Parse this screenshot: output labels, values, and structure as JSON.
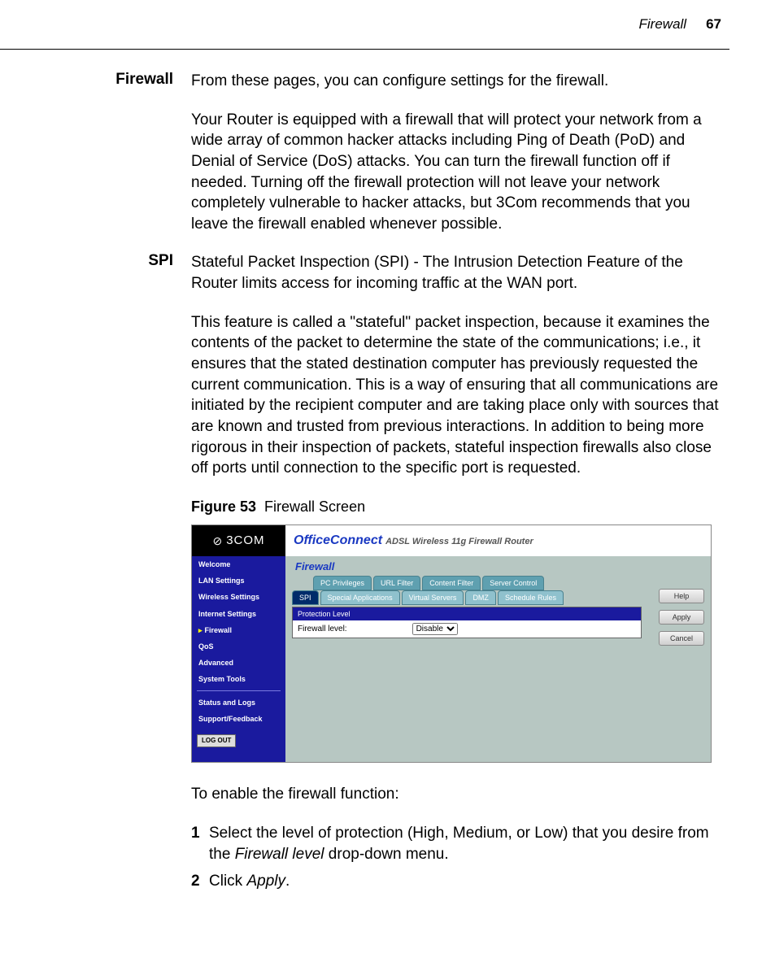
{
  "header": {
    "label": "Firewall",
    "page_number": "67"
  },
  "section1": {
    "heading": "Firewall",
    "p1": "From these pages, you can configure settings for the firewall.",
    "p2": "Your Router is equipped with a firewall that will protect your network from a wide array of common hacker attacks including Ping of Death (PoD) and Denial of Service (DoS) attacks. You can turn the firewall function off if needed. Turning off the firewall protection will not leave your network completely vulnerable to hacker attacks, but 3Com recommends that you leave the firewall enabled whenever possible."
  },
  "section2": {
    "heading": "SPI",
    "p1": "Stateful Packet Inspection (SPI) - The Intrusion Detection Feature of the Router limits access for incoming traffic at the WAN port.",
    "p2": "This feature is called a \"stateful\" packet inspection, because it examines the contents of the packet to determine the state of the communications; i.e., it ensures that the stated destination computer has previously requested the current communication. This is a way of ensuring that all communications are initiated by the recipient computer and are taking place only with sources that are known and trusted from previous interactions. In addition to being more rigorous in their inspection of packets, stateful inspection firewalls also close off ports until connection to the specific port is requested."
  },
  "figure": {
    "label": "Figure 53",
    "caption": "Firewall Screen"
  },
  "screenshot": {
    "brand": "3COM",
    "product_main": "OfficeConnect",
    "product_sub": "ADSL Wireless 11g Firewall Router",
    "section_title": "Firewall",
    "sidebar": {
      "items": [
        {
          "label": "Welcome"
        },
        {
          "label": "LAN Settings"
        },
        {
          "label": "Wireless Settings"
        },
        {
          "label": "Internet Settings"
        },
        {
          "label": "Firewall",
          "active": true
        },
        {
          "label": "QoS"
        },
        {
          "label": "Advanced"
        },
        {
          "label": "System Tools"
        }
      ],
      "items2": [
        {
          "label": "Status and Logs"
        },
        {
          "label": "Support/Feedback"
        }
      ],
      "logout": "LOG OUT"
    },
    "tabs_row1": [
      {
        "label": "PC Privileges"
      },
      {
        "label": "URL Filter"
      },
      {
        "label": "Content Filter"
      },
      {
        "label": "Server Control"
      }
    ],
    "tabs_row2": [
      {
        "label": "SPI",
        "active": true
      },
      {
        "label": "Special Applications"
      },
      {
        "label": "Virtual Servers"
      },
      {
        "label": "DMZ"
      },
      {
        "label": "Schedule Rules"
      }
    ],
    "panel": {
      "header": "Protection Level",
      "field_label": "Firewall level:",
      "select_value": "Disable"
    },
    "right_buttons": {
      "help": "Help",
      "apply": "Apply",
      "cancel": "Cancel"
    }
  },
  "steps": {
    "intro": "To enable the firewall function:",
    "s1_num": "1",
    "s1a": "Select the level of protection (High, Medium, or Low) that you desire from the ",
    "s1b": "Firewall level",
    "s1c": " drop-down menu.",
    "s2_num": "2",
    "s2a": "Click ",
    "s2b": "Apply",
    "s2c": "."
  }
}
